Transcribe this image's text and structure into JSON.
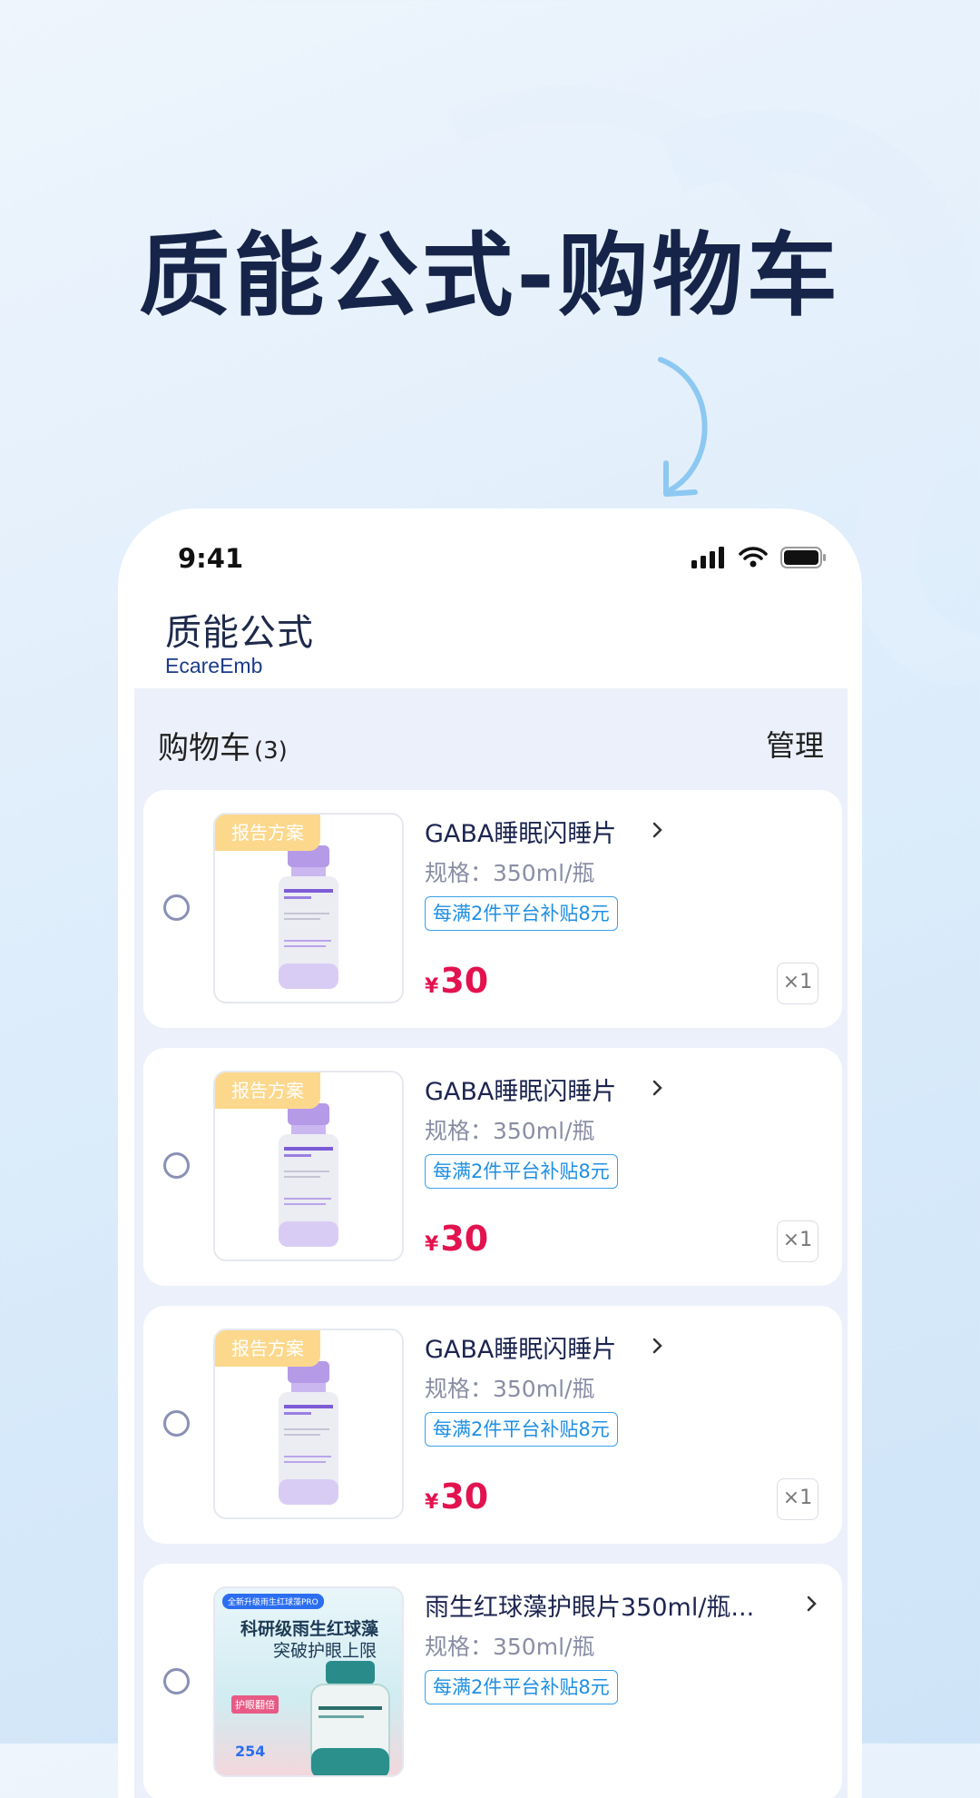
{
  "headline": "质能公式-购物车",
  "status_bar": {
    "time": "9:41"
  },
  "logo": {
    "cn": "质能公式",
    "en": "EcareEmb"
  },
  "cart": {
    "title": "购物车",
    "count": "(3)",
    "manage_label": "管理"
  },
  "items": [
    {
      "badge": "报告方案",
      "name": "GABA睡眠闪睡片",
      "spec": "规格：350ml/瓶",
      "promo": "每满2件平台补贴8元",
      "currency": "¥",
      "price": "30",
      "qty": "×1"
    },
    {
      "badge": "报告方案",
      "name": "GABA睡眠闪睡片",
      "spec": "规格：350ml/瓶",
      "promo": "每满2件平台补贴8元",
      "currency": "¥",
      "price": "30",
      "qty": "×1"
    },
    {
      "badge": "报告方案",
      "name": "GABA睡眠闪睡片",
      "spec": "规格：350ml/瓶",
      "promo": "每满2件平台补贴8元",
      "currency": "¥",
      "price": "30",
      "qty": "×1"
    },
    {
      "name": "雨生红球藻护眼片350ml/瓶...",
      "spec": "规格：350ml/瓶",
      "promo": "每满2件平台补贴8元",
      "ad": {
        "pill": "全新升级雨生红球藻PRO",
        "line1": "科研级雨生红球藻",
        "line2": "突破护眼上限",
        "mark": "护眼翻倍",
        "num": "254"
      }
    }
  ],
  "colors": {
    "price": "#e2134f",
    "promo": "#1f8fe3",
    "badge": "#fcd88d",
    "headline": "#172449"
  }
}
